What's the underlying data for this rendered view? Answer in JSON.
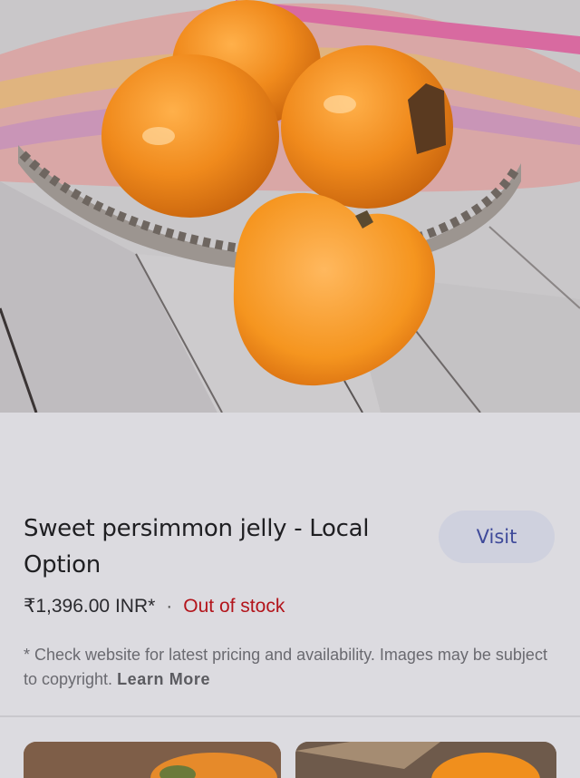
{
  "product": {
    "title": "Sweet persimmon jelly - Local Option",
    "visit_label": "Visit",
    "price": "₹1,396.00 INR*",
    "separator": "·",
    "stock_status": "Out of stock",
    "disclaimer": "* Check website for latest pricing and availability. Images may be subject to copyright.",
    "learn_more_label": "Learn More"
  },
  "colors": {
    "stock_status": "#b3141b",
    "visit_button_bg": "#cfd1de",
    "visit_button_text": "#3f4a9a"
  }
}
